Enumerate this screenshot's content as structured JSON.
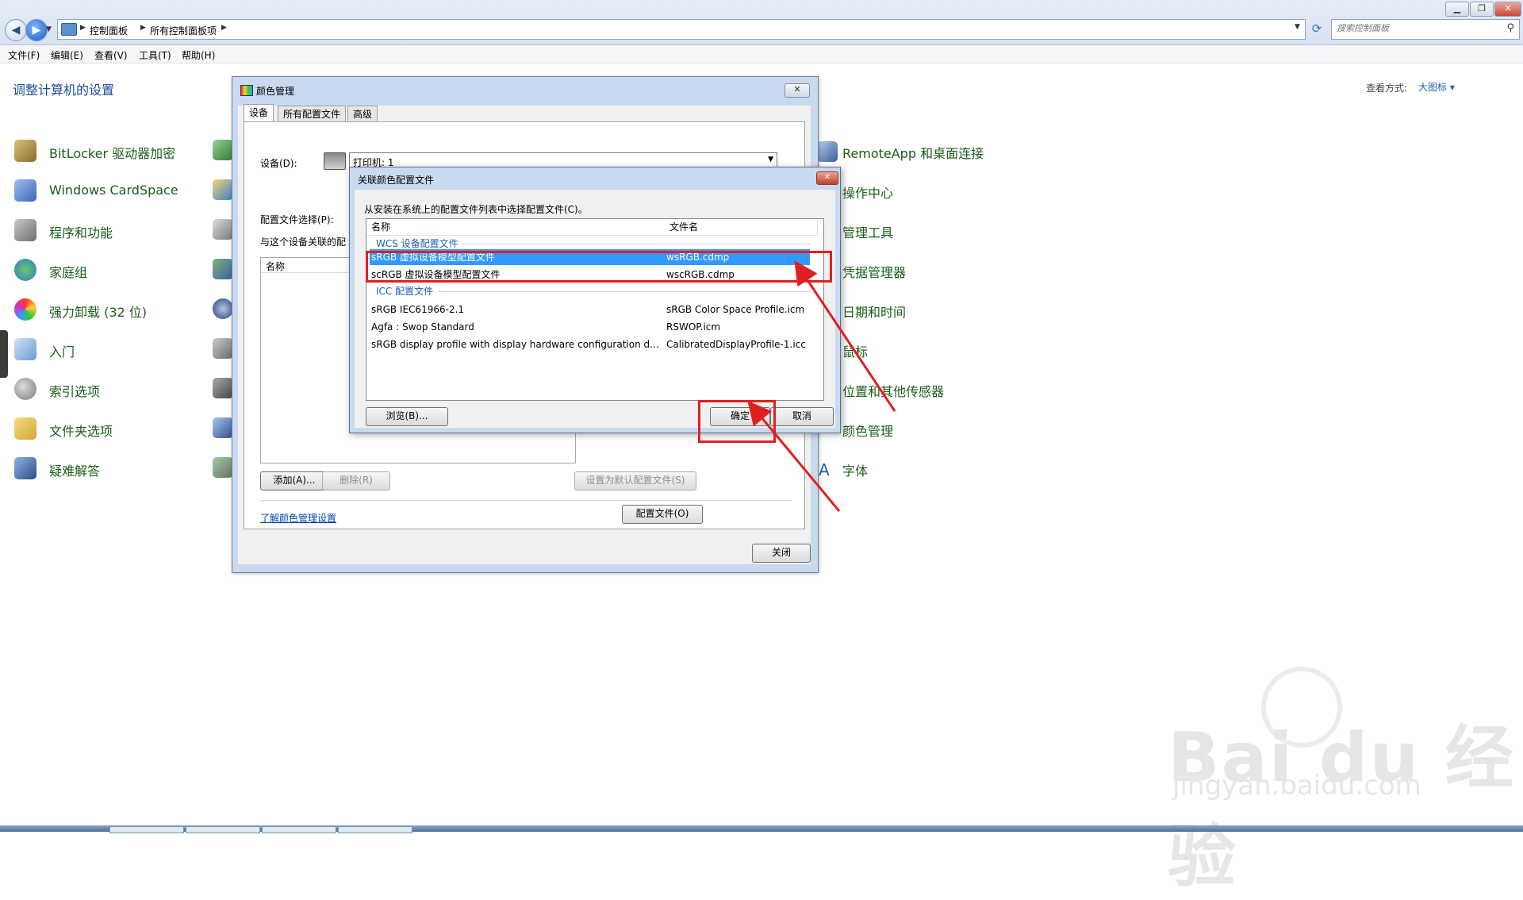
{
  "explorer": {
    "breadcrumbs": [
      "控制面板",
      "所有控制面板项"
    ],
    "search_placeholder": "搜索控制面板",
    "menu": [
      "文件(F)",
      "编辑(E)",
      "查看(V)",
      "工具(T)",
      "帮助(H)"
    ],
    "page_title": "调整计算机的设置",
    "view_label": "查看方式:",
    "view_value": "大图标 ▾"
  },
  "left_items": [
    "BitLocker 驱动器加密",
    "Windows CardSpace",
    "程序和功能",
    "家庭组",
    "强力卸载 (32 位)",
    "入门",
    "索引选项",
    "文件夹选项",
    "疑难解答"
  ],
  "right_items": [
    "RemoteApp 和桌面连接",
    "操作中心",
    "管理工具",
    "凭据管理器",
    "日期和时间",
    "鼠标",
    "位置和其他传感器",
    "颜色管理",
    "字体"
  ],
  "color_mgmt": {
    "title": "颜色管理",
    "tabs": [
      "设备",
      "所有配置文件",
      "高级"
    ],
    "device_label": "设备(D):",
    "device_value": "打印机: 1",
    "profile_select_label": "配置文件选择(P):",
    "assoc_label": "与这个设备关联的配",
    "list_header": "名称",
    "add_btn": "添加(A)...",
    "remove_btn": "删除(R)",
    "set_default_btn": "设置为默认配置文件(S)",
    "learn_link": "了解颜色管理设置",
    "profile_btn": "配置文件(O)",
    "close_btn": "关闭"
  },
  "assoc_dialog": {
    "title": "关联颜色配置文件",
    "instruction": "从安装在系统上的配置文件列表中选择配置文件(C)。",
    "col_name": "名称",
    "col_file": "文件名",
    "group_wcs": "WCS 设备配置文件",
    "group_icc": "ICC 配置文件",
    "rows_wcs": [
      {
        "name": "sRGB 虚拟设备模型配置文件",
        "file": "wsRGB.cdmp"
      },
      {
        "name": "scRGB 虚拟设备模型配置文件",
        "file": "wscRGB.cdmp"
      }
    ],
    "rows_icc": [
      {
        "name": "sRGB IEC61966-2.1",
        "file": "sRGB Color Space Profile.icm"
      },
      {
        "name": "Agfa : Swop Standard",
        "file": "RSWOP.icm"
      },
      {
        "name": "sRGB display profile with display hardware configuration dat...",
        "file": "CalibratedDisplayProfile-1.icc"
      }
    ],
    "browse_btn": "浏览(B)...",
    "ok_btn": "确定",
    "cancel_btn": "取消"
  },
  "watermark": {
    "logo": "Bai du 经验",
    "url": "jingyan.baidu.com"
  },
  "colors": {
    "selection": "#3399ff",
    "annotation": "#e02020",
    "link": "#1e5fb8"
  }
}
